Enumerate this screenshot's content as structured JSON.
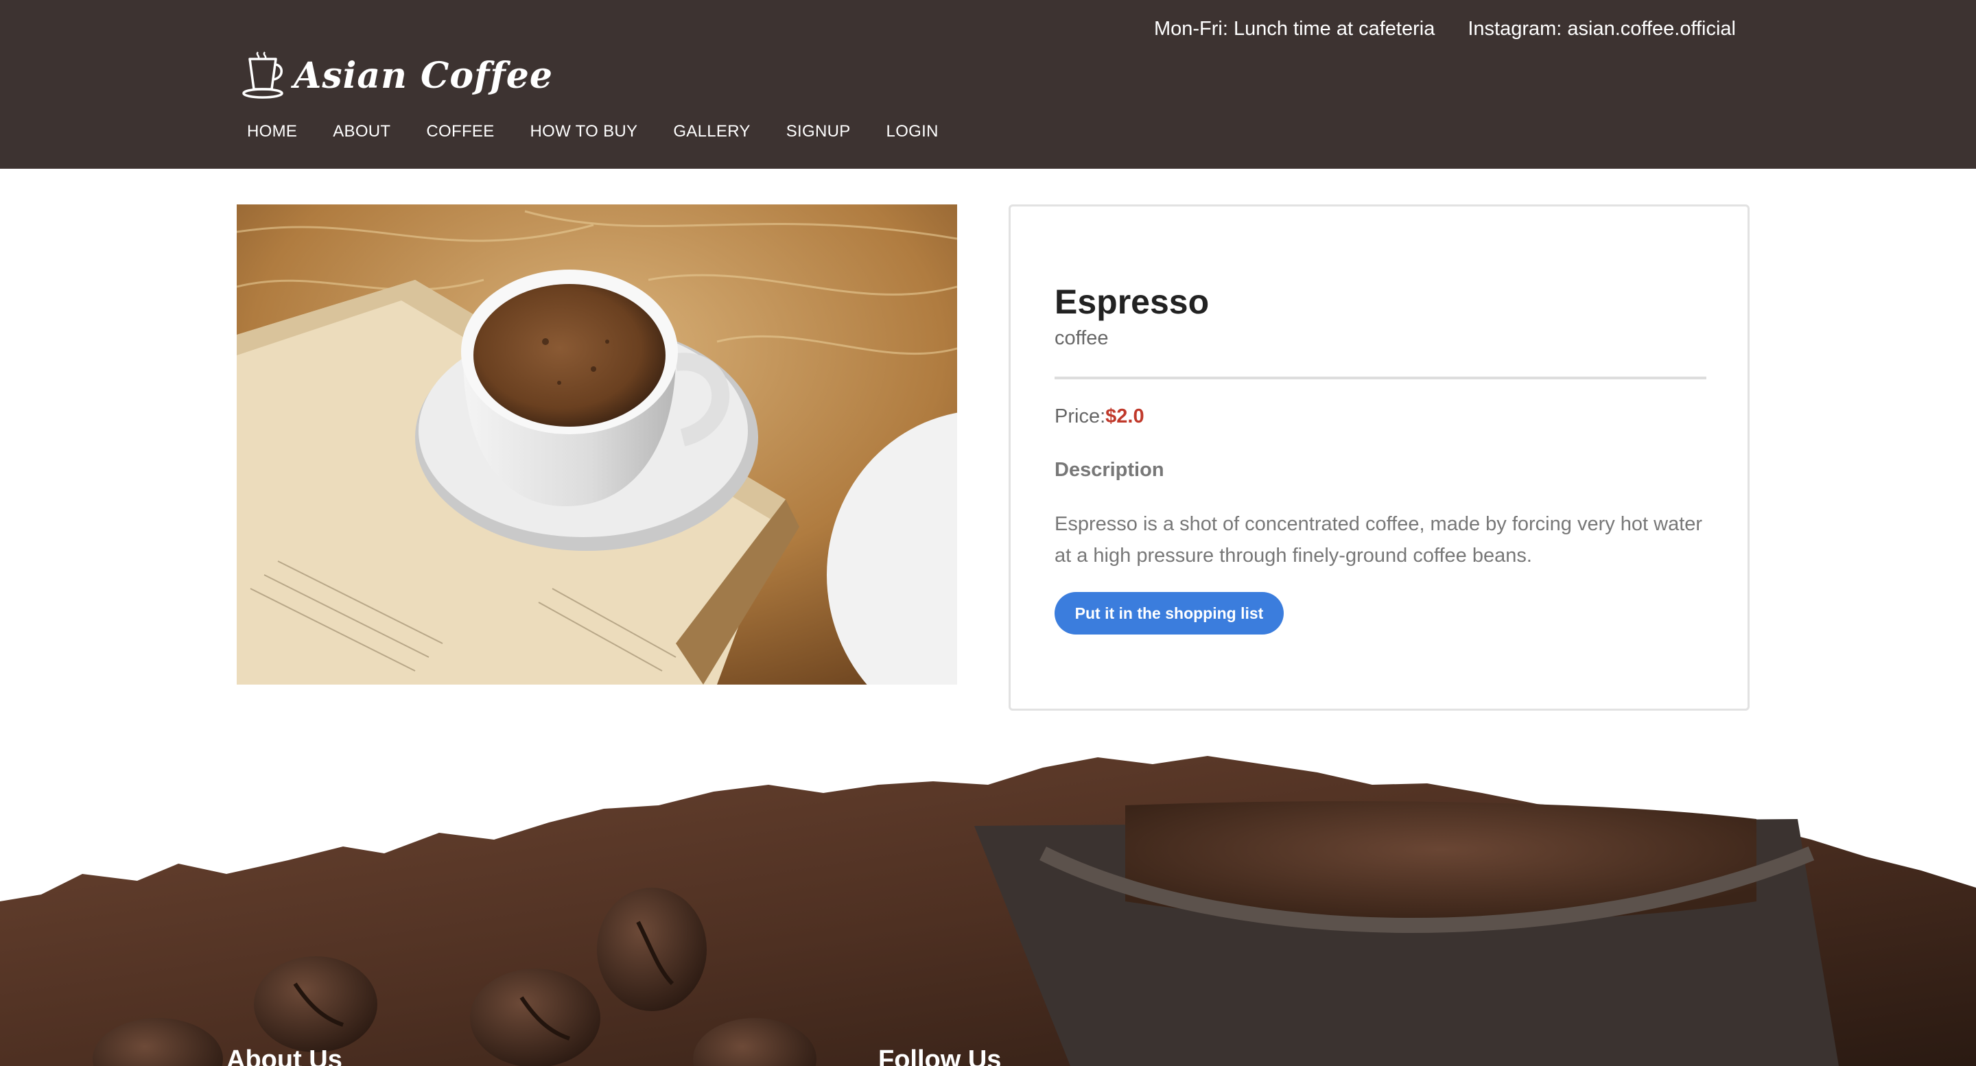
{
  "header": {
    "info_hours": "Mon-Fri: Lunch time at cafeteria",
    "info_instagram": "Instagram: asian.coffee.official",
    "logo_text": "Asian Coffee"
  },
  "nav": {
    "items": [
      "HOME",
      "ABOUT",
      "COFFEE",
      "HOW TO BUY",
      "GALLERY",
      "SIGNUP",
      "LOGIN"
    ]
  },
  "product": {
    "name": "Espresso",
    "category": "coffee",
    "price_label": "Price:",
    "price_value": "$2.0",
    "description_heading": "Description",
    "description": "Espresso is a shot of concentrated coffee, made by forcing very hot water at a high pressure through finely-ground coffee beans.",
    "cart_button_label": "Put it in the shopping list"
  },
  "footer": {
    "about_heading": "About Us",
    "follow_heading": "Follow Us"
  },
  "colors": {
    "header_bg": "#3d3331",
    "price": "#c0392b",
    "button": "#3b7ddd"
  }
}
